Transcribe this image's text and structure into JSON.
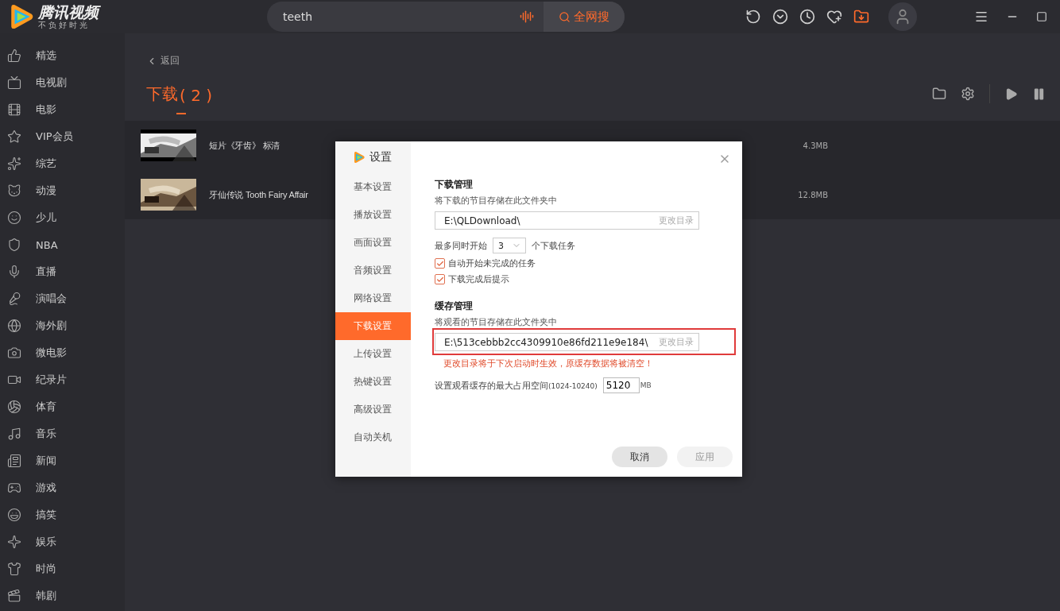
{
  "app": {
    "logo_title": "腾讯视频",
    "logo_slogan": "不负好时光"
  },
  "search": {
    "value": "teeth",
    "button": "全网搜"
  },
  "top_icons": [
    {
      "kind": "refresh",
      "selected": false
    },
    {
      "kind": "chevron",
      "selected": false
    },
    {
      "kind": "clock",
      "selected": false
    },
    {
      "kind": "heart",
      "selected": false
    },
    {
      "kind": "download",
      "selected": true
    }
  ],
  "sidebar": {
    "items": [
      {
        "kind": "thumb",
        "label": "精选"
      },
      {
        "kind": "tv",
        "label": "电视剧"
      },
      {
        "kind": "film",
        "label": "电影"
      },
      {
        "kind": "star",
        "label": "VIP会员"
      },
      {
        "kind": "sparkles",
        "label": "综艺"
      },
      {
        "kind": "cat",
        "label": "动漫"
      },
      {
        "kind": "smile",
        "label": "少儿"
      },
      {
        "kind": "shield",
        "label": "NBA"
      },
      {
        "kind": "mic",
        "label": "直播"
      },
      {
        "kind": "mic2",
        "label": "演唱会"
      },
      {
        "kind": "globe",
        "label": "海外剧"
      },
      {
        "kind": "camera",
        "label": "微电影"
      },
      {
        "kind": "video",
        "label": "纪录片"
      },
      {
        "kind": "ball",
        "label": "体育"
      },
      {
        "kind": "music",
        "label": "音乐"
      },
      {
        "kind": "news",
        "label": "新闻"
      },
      {
        "kind": "game",
        "label": "游戏"
      },
      {
        "kind": "laugh",
        "label": "搞笑"
      },
      {
        "kind": "sparkle",
        "label": "娱乐"
      },
      {
        "kind": "shirt",
        "label": "时尚"
      },
      {
        "kind": "clapper",
        "label": "韩剧"
      }
    ]
  },
  "main": {
    "back": "返回",
    "title": "下载",
    "count": "( 2 )"
  },
  "downloads": [
    {
      "title": "短片《牙齿》 标清",
      "size": "4.3MB"
    },
    {
      "title": "牙仙传说 Tooth Fairy Affair",
      "size": "12.8MB"
    }
  ],
  "dialog": {
    "title": "设置",
    "nav": [
      {
        "label": "基本设置",
        "selected": false
      },
      {
        "label": "播放设置",
        "selected": false
      },
      {
        "label": "画面设置",
        "selected": false
      },
      {
        "label": "音频设置",
        "selected": false
      },
      {
        "label": "网络设置",
        "selected": false
      },
      {
        "label": "下载设置",
        "selected": true
      },
      {
        "label": "上传设置",
        "selected": false
      },
      {
        "label": "热键设置",
        "selected": false
      },
      {
        "label": "高级设置",
        "selected": false
      },
      {
        "label": "自动关机",
        "selected": false
      }
    ],
    "download": {
      "heading": "下载管理",
      "description": "将下载的节目存储在此文件夹中",
      "path": "E:\\QLDownload\\",
      "change": "更改目录",
      "max_prefix": "最多同时开始",
      "max_value": "3",
      "max_suffix": "个下载任务",
      "options": [
        {
          "label": "自动开始未完成的任务",
          "checked": true
        },
        {
          "label": "下载完成后提示",
          "checked": true
        }
      ]
    },
    "cache": {
      "heading": "缓存管理",
      "description": "将观看的节目存储在此文件夹中",
      "path": "E:\\513cebbb2cc4309910e86fd211e9e184\\",
      "change": "更改目录",
      "highlighted": true,
      "warning": "更改目录将于下次启动时生效，原缓存数据将被清空！",
      "size_label": "设置观看缓存的最大占用空间",
      "size_range": "(1024-10240)",
      "size_value": "5120",
      "size_unit": "MB"
    },
    "buttons": [
      {
        "label": "取消",
        "disabled": false
      },
      {
        "label": "应用",
        "disabled": true
      }
    ]
  }
}
